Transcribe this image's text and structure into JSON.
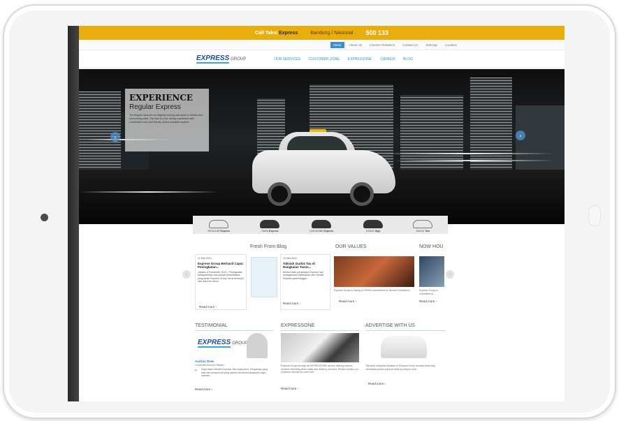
{
  "topbar": {
    "call_prefix": "Call Taksi",
    "call_brand": "Express",
    "call_label": "Bandung / Nasional",
    "number": "500 133"
  },
  "subnav": [
    "Home",
    "About Us",
    "Investor Relations",
    "Contact Us",
    "Sitemap",
    "Location"
  ],
  "logo": {
    "letter": "E",
    "word": "XPRESS",
    "group": "GROUP"
  },
  "mainnav": [
    "OUR SERVICES",
    "CUSTOMER ZONE",
    "EXPRESSONE",
    "CAREER",
    "BLOG"
  ],
  "hero": {
    "title": "EXPERIENCE",
    "subtitle": "Regular Express",
    "body": "The Regular taxis are our flagship serving vast areas in Jakarta and surrounding cities. The fleet is a fine driving experience with comfortable rides and friendly drivers available anytime."
  },
  "fleet": [
    {
      "name": "REGULAR",
      "brand": "Express",
      "dark": false
    },
    {
      "name": "TIARA",
      "brand": "Express",
      "dark": true
    },
    {
      "name": "LIMOUSINE",
      "brand": "Express",
      "dark": true
    },
    {
      "name": "EAGLE",
      "brand": "High",
      "dark": true
    },
    {
      "name": "EAGLE",
      "brand": "Taxi",
      "dark": false
    }
  ],
  "sections": {
    "blog": "Fresh From Blog",
    "values": "OUR VALUES",
    "now": "NOW HOU",
    "testimonial": "TESTIMONIAL",
    "expressone": "EXPRESSONE",
    "advertise": "ADVERTISE WITH US"
  },
  "blog_cards": [
    {
      "date": "10 Des 2012",
      "title": "Express Group Berhasil Capai Peningkatan...",
      "body": "Jakarta, 8 December 2012 - Peningkatan kesejahteraan dan jumlah keberhasilan yang diraih Express Group, terus berlanjut dari tahun ke tahun.",
      "read": "Read more"
    },
    {
      "date": "10 Des 2012",
      "title": "Taksiah Gurbiz Tax di Rangkaian Tasim...",
      "body": "Berikut ialah penjelasan Express Taxi sebagaimana disebutkan oleh Direksi Express pada tanggal...",
      "read": "Read more"
    }
  ],
  "values": {
    "body": "Express Group is having a 100000 commitment to Service Excellence...",
    "read": "Read more"
  },
  "now": {
    "body": "Express Group is committed to...",
    "read": "Read more"
  },
  "testimonial": {
    "name": "Andrini Dewi",
    "role": "Corporate Account Taksiku",
    "quote": "Saya telah memilih Express Taxi sejak lama. Pelayanan yang baik dan pengemudi yang ramah membuat perjalanan saya nyaman.",
    "read": "Read more"
  },
  "expressone": {
    "body": "Express Group through its EXPRESSONE service offering various services including direct sales and delivery services. Please contact our customer service for more info.",
    "read": "Read more"
  },
  "advertise": {
    "body": "Tak akan menyesal beriklan di Express Group armada kami siap membawa pesan anda ke seluruh penjuru kota.",
    "read": "Read more"
  }
}
